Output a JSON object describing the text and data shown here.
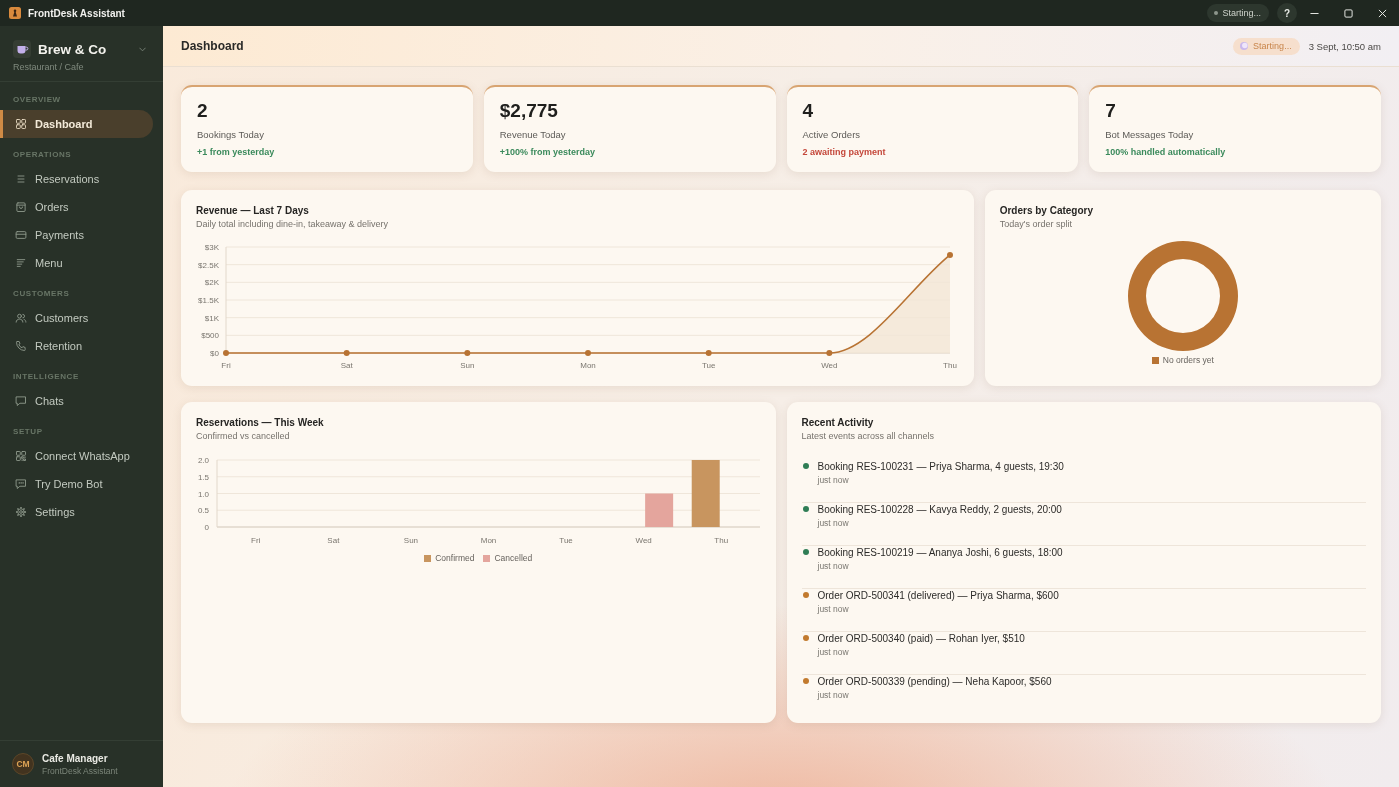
{
  "window": {
    "title": "FrontDesk Assistant",
    "status": "Starting...",
    "help": "?"
  },
  "sidebar": {
    "brand": {
      "name": "Brew & Co",
      "subtitle": "Restaurant / Cafe"
    },
    "sections": [
      {
        "title": "OVERVIEW",
        "items": [
          {
            "label": "Dashboard",
            "selected": true
          }
        ]
      },
      {
        "title": "OPERATIONS",
        "items": [
          {
            "label": "Reservations",
            "selected": false
          },
          {
            "label": "Orders",
            "selected": false
          },
          {
            "label": "Payments",
            "selected": false
          },
          {
            "label": "Menu",
            "selected": false
          }
        ]
      },
      {
        "title": "CUSTOMERS",
        "items": [
          {
            "label": "Customers",
            "selected": false
          },
          {
            "label": "Retention",
            "selected": false
          }
        ]
      },
      {
        "title": "INTELLIGENCE",
        "items": [
          {
            "label": "Chats",
            "selected": false
          }
        ]
      },
      {
        "title": "SETUP",
        "items": [
          {
            "label": "Connect WhatsApp",
            "selected": false
          },
          {
            "label": "Try Demo Bot",
            "selected": false
          },
          {
            "label": "Settings",
            "selected": false
          }
        ]
      }
    ],
    "user": {
      "initials": "CM",
      "name": "Cafe Manager",
      "role": "FrontDesk Assistant"
    }
  },
  "header": {
    "title": "Dashboard",
    "status": "Starting...",
    "datetime": "3 Sept, 10:50 am"
  },
  "stats": [
    {
      "value": "2",
      "label": "Bookings Today",
      "note": "+1 from yesterday",
      "color": "#3b8a5c"
    },
    {
      "value": "$2,775",
      "label": "Revenue Today",
      "note": "+100% from yesterday",
      "color": "#3b8a5c"
    },
    {
      "value": "4",
      "label": "Active Orders",
      "note": "2 awaiting payment",
      "color": "#c4473a"
    },
    {
      "value": "7",
      "label": "Bot Messages Today",
      "note": "100% handled automatically",
      "color": "#3b8a5c"
    }
  ],
  "revenue_chart": {
    "title": "Revenue — Last 7 Days",
    "subtitle": "Daily total including dine-in, takeaway & delivery",
    "chart_data": {
      "type": "area",
      "categories": [
        "Fri",
        "Sat",
        "Sun",
        "Mon",
        "Tue",
        "Wed",
        "Thu"
      ],
      "values": [
        0,
        0,
        0,
        0,
        0,
        0,
        2775
      ],
      "ylim": [
        0,
        3000
      ],
      "yticks": [
        {
          "value": 0,
          "label": "$0"
        },
        {
          "value": 500,
          "label": "$500"
        },
        {
          "value": 1000,
          "label": "$1K"
        },
        {
          "value": 1500,
          "label": "$1.5K"
        },
        {
          "value": 2000,
          "label": "$2K"
        },
        {
          "value": 2500,
          "label": "$2.5K"
        },
        {
          "value": 3000,
          "label": "$3K"
        }
      ],
      "grid": true
    }
  },
  "category_chart": {
    "title": "Orders by Category",
    "subtitle": "Today's order split",
    "legend": [
      {
        "label": "No orders yet",
        "color": "#b87333"
      }
    ]
  },
  "reservations_chart": {
    "title": "Reservations — This Week",
    "subtitle": "Confirmed vs cancelled",
    "chart_data": {
      "type": "bar",
      "categories": [
        "Fri",
        "Sat",
        "Sun",
        "Mon",
        "Tue",
        "Wed",
        "Thu"
      ],
      "series": [
        {
          "name": "Confirmed",
          "color": "#c8955f",
          "values": [
            0,
            0,
            0,
            0,
            0,
            0,
            2
          ]
        },
        {
          "name": "Cancelled",
          "color": "#e4a59d",
          "values": [
            0,
            0,
            0,
            0,
            0,
            1,
            0
          ]
        }
      ],
      "stacked": false,
      "ylim": [
        0,
        2
      ],
      "yticks": [
        {
          "value": 0,
          "label": "0"
        },
        {
          "value": 0.5,
          "label": "0.5"
        },
        {
          "value": 1,
          "label": "1.0"
        },
        {
          "value": 1.5,
          "label": "1.5"
        },
        {
          "value": 2,
          "label": "2.0"
        }
      ],
      "grid": true
    }
  },
  "activity": {
    "title": "Recent Activity",
    "subtitle": "Latest events across all channels",
    "items": [
      {
        "text": "Booking RES-100231 — Priya Sharma, 4 guests, 19:30",
        "time": "just now",
        "color": "#2f7d55"
      },
      {
        "text": "Booking RES-100228 — Kavya Reddy, 2 guests, 20:00",
        "time": "just now",
        "color": "#2f7d55"
      },
      {
        "text": "Booking RES-100219 — Ananya Joshi, 6 guests, 18:00",
        "time": "just now",
        "color": "#2f7d55"
      },
      {
        "text": "Order ORD-500341 (delivered) — Priya Sharma, $600",
        "time": "just now",
        "color": "#c27a2e"
      },
      {
        "text": "Order ORD-500340 (paid) — Rohan Iyer, $510",
        "time": "just now",
        "color": "#c27a2e"
      },
      {
        "text": "Order ORD-500339 (pending) — Neha Kapoor, $560",
        "time": "just now",
        "color": "#c27a2e"
      }
    ]
  }
}
